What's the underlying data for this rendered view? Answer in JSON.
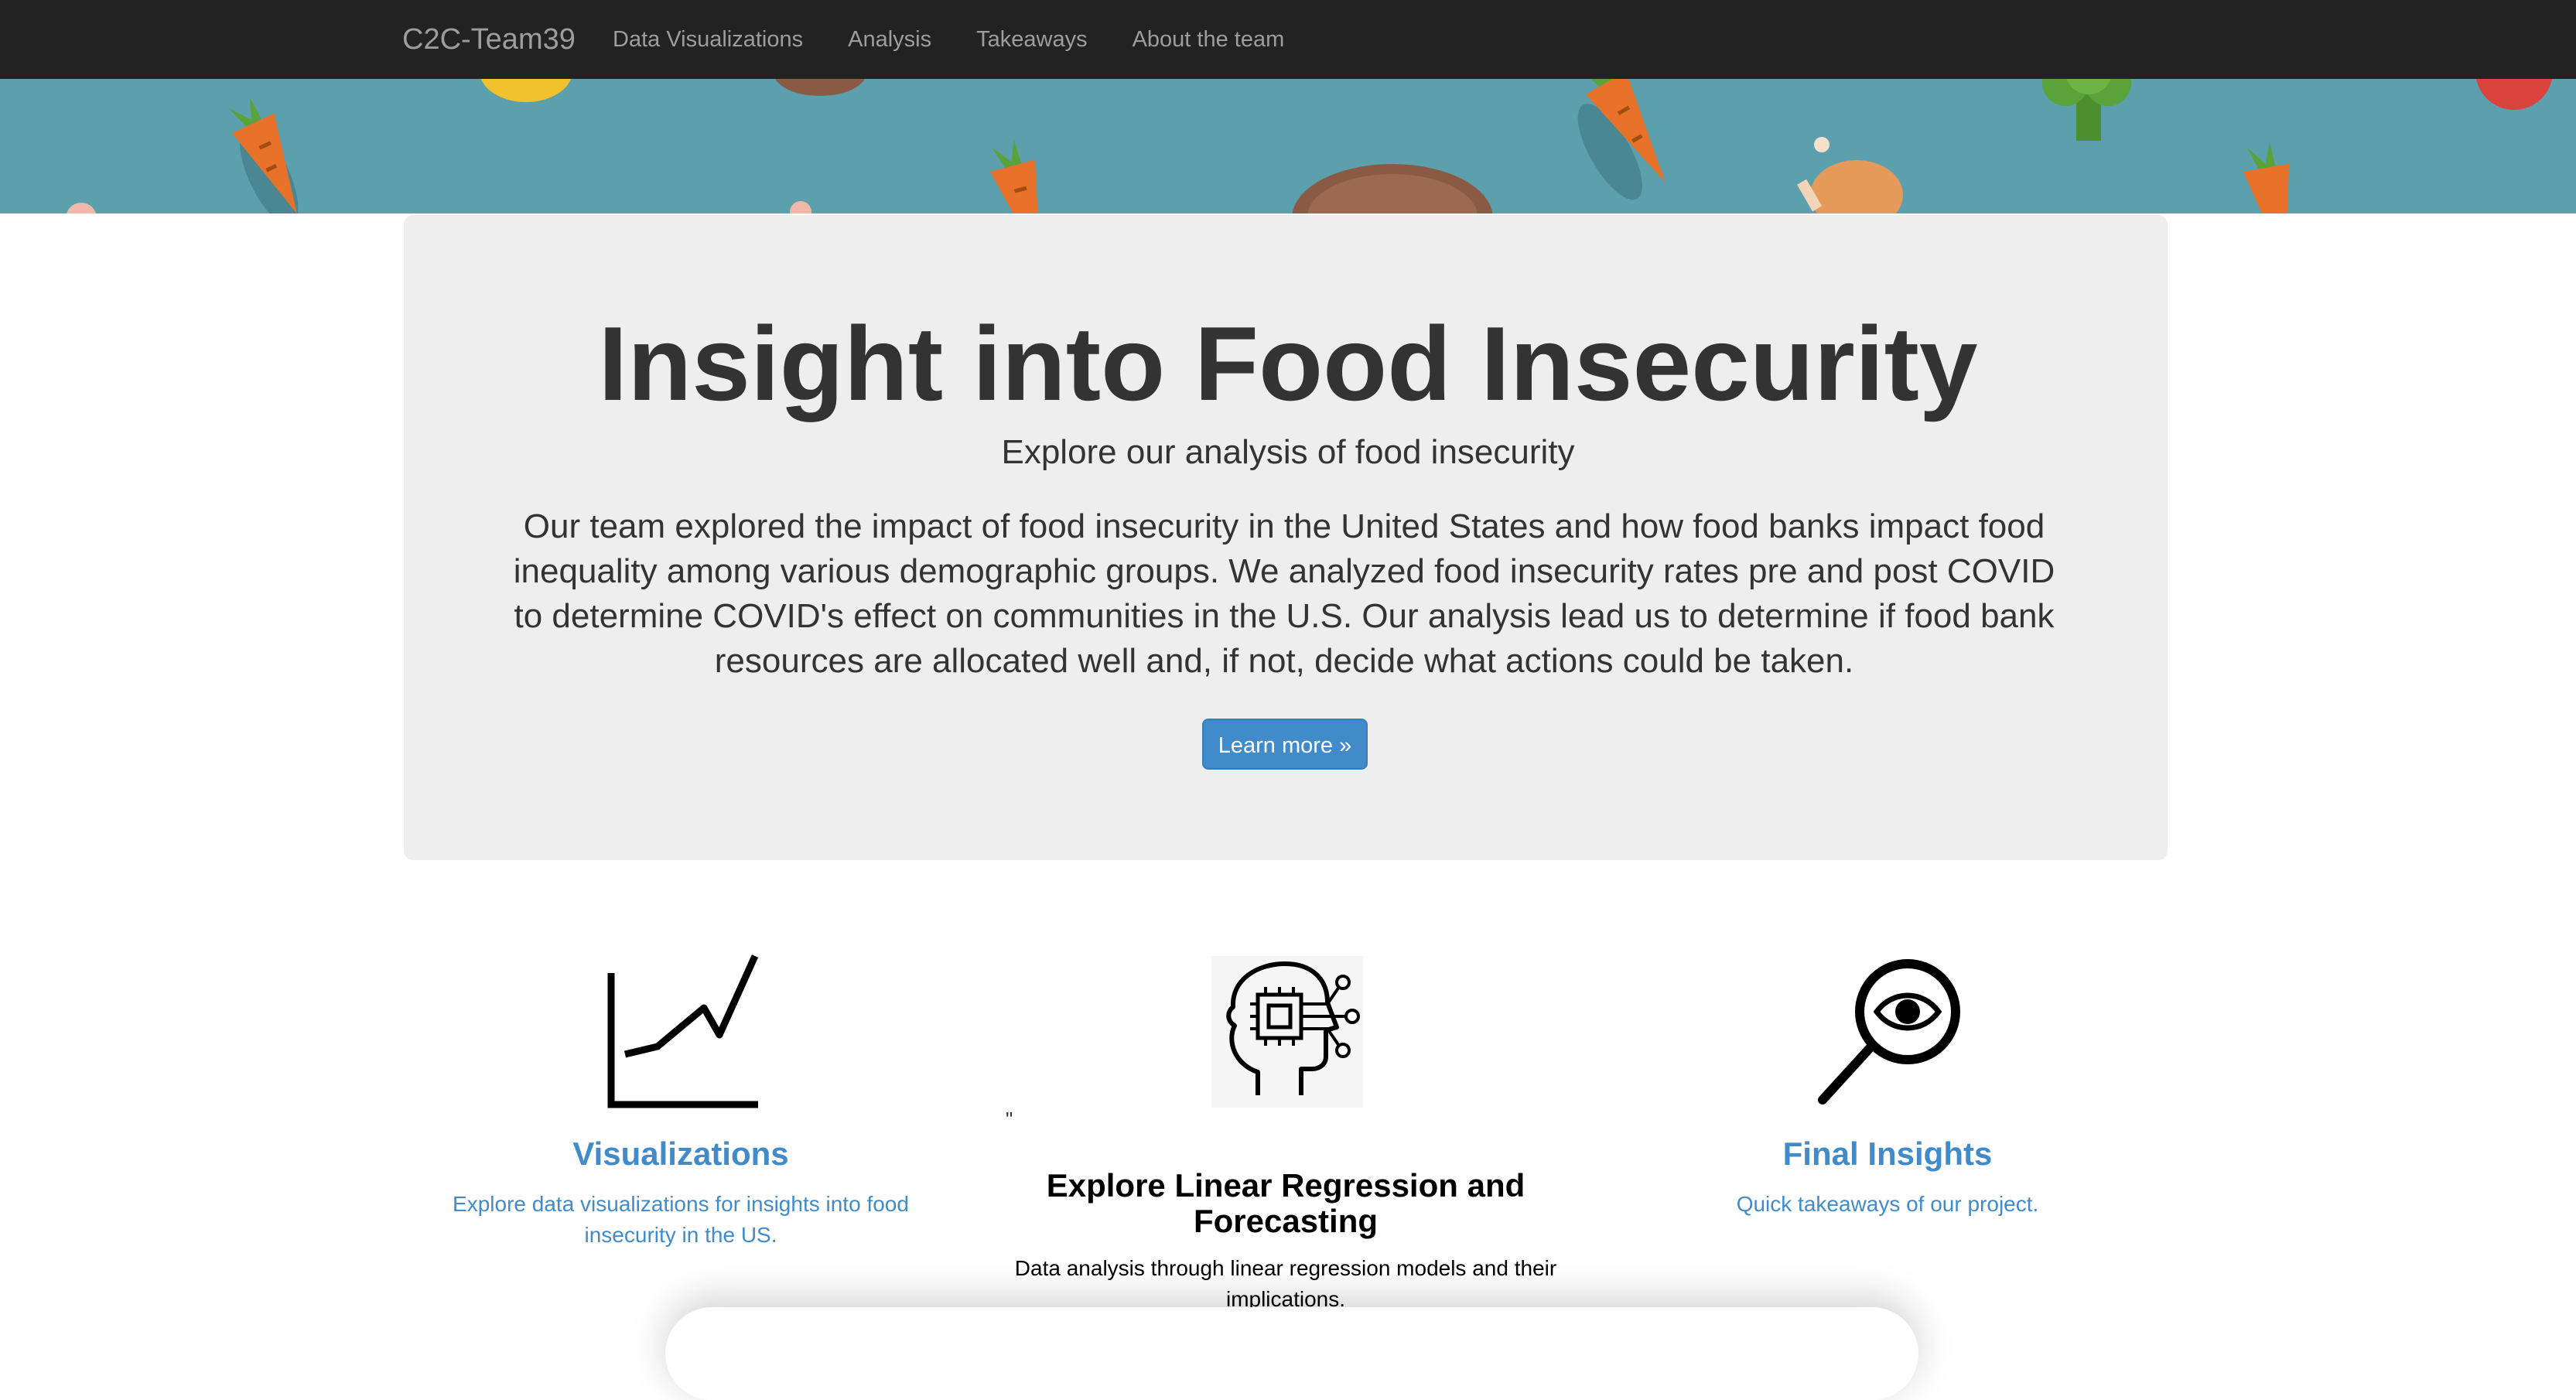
{
  "navbar": {
    "brand": "C2C-Team39",
    "links": [
      "Data Visualizations",
      "Analysis",
      "Takeaways",
      "About the team"
    ]
  },
  "jumbotron": {
    "title": "Insight into Food Insecurity",
    "subtitle": "Explore our analysis of food insecurity",
    "body": "Our team explored the impact of food insecurity in the United States and how food banks impact food inequality among various demographic groups. We analyzed food insecurity rates pre and post COVID to determine COVID's effect on communities in the U.S. Our analysis lead us to determine if food bank resources are allocated well and, if not, decide what actions could be taken.",
    "button_label": "Learn more »"
  },
  "features": [
    {
      "icon": "line-chart-icon",
      "title": "Visualizations",
      "description": "Explore data visualizations for insights into food insecurity in the US."
    },
    {
      "icon": "ai-head-icon",
      "title": "Explore Linear Regression and Forecasting",
      "description": "Data analysis through linear regression models and their implications."
    },
    {
      "icon": "magnifier-eye-icon",
      "title": "Final Insights",
      "description": "Quick takeaways of our project."
    }
  ],
  "stray_text": "\"",
  "colors": {
    "navbar_bg": "#222222",
    "nav_text": "#9d9d9d",
    "jumbotron_bg": "#eeeeee",
    "link_blue": "#428bca",
    "banner_teal": "#5c9fad"
  }
}
